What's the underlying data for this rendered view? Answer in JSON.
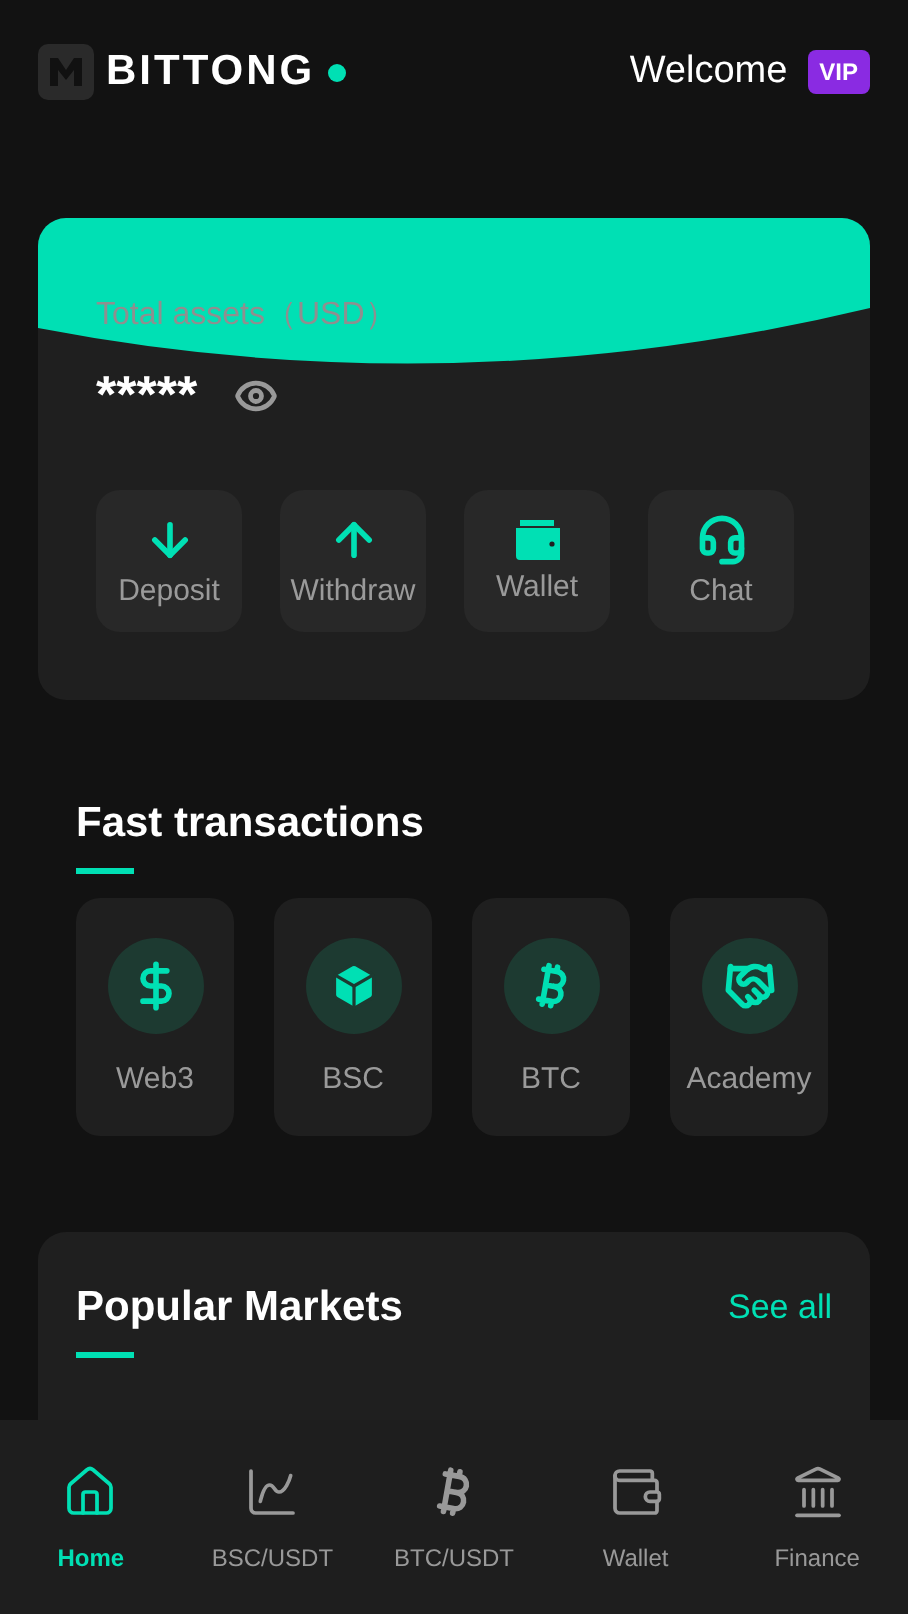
{
  "header": {
    "brand": "BITTONG",
    "welcome": "Welcome",
    "badge": "VIP"
  },
  "assets": {
    "label": "Total assets（USD）",
    "value": "*****",
    "actions": [
      {
        "label": "Deposit",
        "kind": "deposit"
      },
      {
        "label": "Withdraw",
        "kind": "withdraw"
      },
      {
        "label": "Wallet",
        "kind": "wallet"
      },
      {
        "label": "Chat",
        "kind": "chat"
      }
    ]
  },
  "fast_transactions": {
    "title": "Fast transactions",
    "items": [
      {
        "label": "Web3",
        "kind": "dollar"
      },
      {
        "label": "BSC",
        "kind": "box"
      },
      {
        "label": "BTC",
        "kind": "bitcoin"
      },
      {
        "label": "Academy",
        "kind": "handshake"
      }
    ]
  },
  "popular_markets": {
    "title": "Popular Markets",
    "link": "See all"
  },
  "bottom_nav": [
    {
      "label": "Home",
      "kind": "home",
      "selected": true
    },
    {
      "label": "BSC/USDT",
      "kind": "chart",
      "selected": false
    },
    {
      "label": "BTC/USDT",
      "kind": "bitcoin",
      "selected": false
    },
    {
      "label": "Wallet",
      "kind": "wallet",
      "selected": false
    },
    {
      "label": "Finance",
      "kind": "bank",
      "selected": false
    }
  ]
}
